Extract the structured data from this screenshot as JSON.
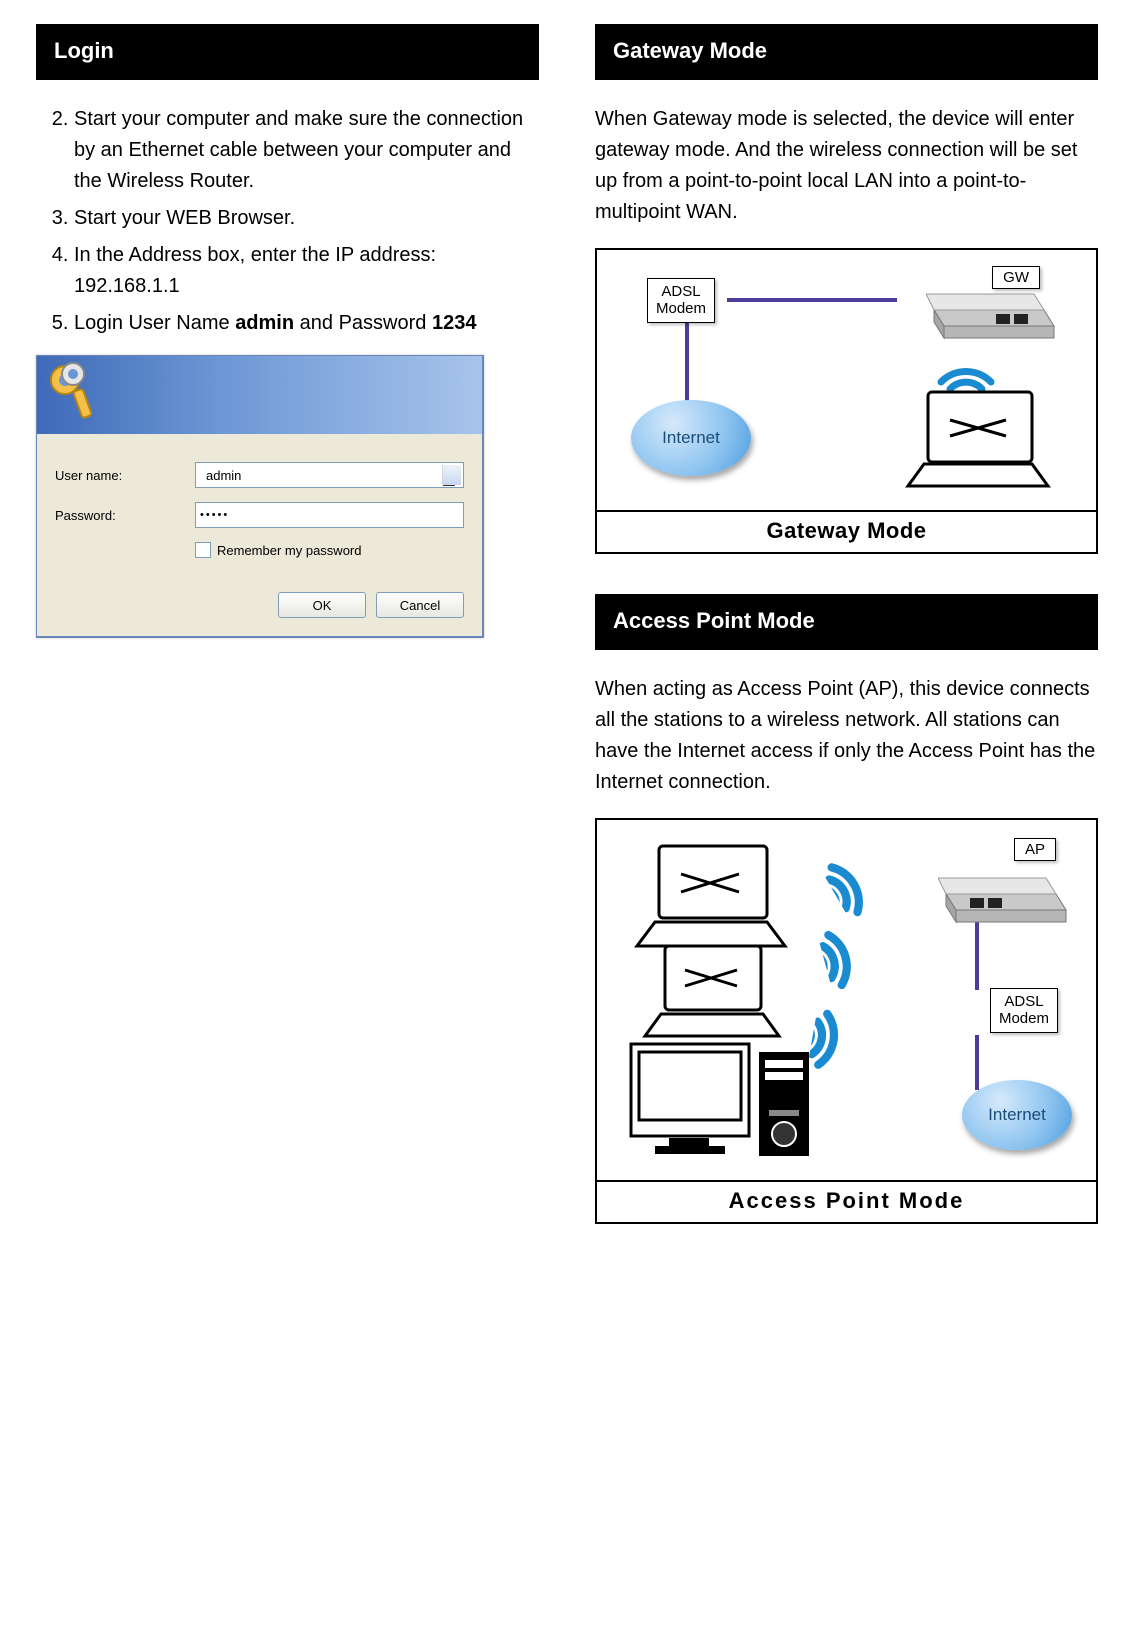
{
  "left": {
    "section_title": "Login",
    "steps": [
      "Start your computer and make sure the connection by an Ethernet cable between your computer and the Wireless Router.",
      "Start your WEB Browser.",
      "In the Address box, enter the IP address: 192.168.1.1",
      "Login User Name <b>admin</b> and Password <b>1234</b>"
    ],
    "start_index": 2,
    "dialog": {
      "user_label": "User name:",
      "pass_label": "Password:",
      "user_value": "admin",
      "pass_value": "•••••",
      "remember_label": "Remember my password",
      "ok": "OK",
      "cancel": "Cancel"
    }
  },
  "right": {
    "gateway": {
      "title": "Gateway Mode",
      "text": "When Gateway mode is selected, the device will enter gateway mode. And the wireless connection will be set up from a point-to-point local LAN into a point-to-multipoint WAN.",
      "caption": "Gateway Mode",
      "adsl_label": "ADSL\nModem",
      "gw_label": "GW",
      "internet_label": "Internet"
    },
    "ap": {
      "title": "Access Point Mode",
      "text": "When acting as Access Point (AP), this device connects all the stations to a wireless network. All stations can have the Internet access if only the Access Point has the Internet connection.",
      "caption": "Access Point Mode",
      "ap_label": "AP",
      "adsl_label": "ADSL\nModem",
      "internet_label": "Internet"
    }
  }
}
